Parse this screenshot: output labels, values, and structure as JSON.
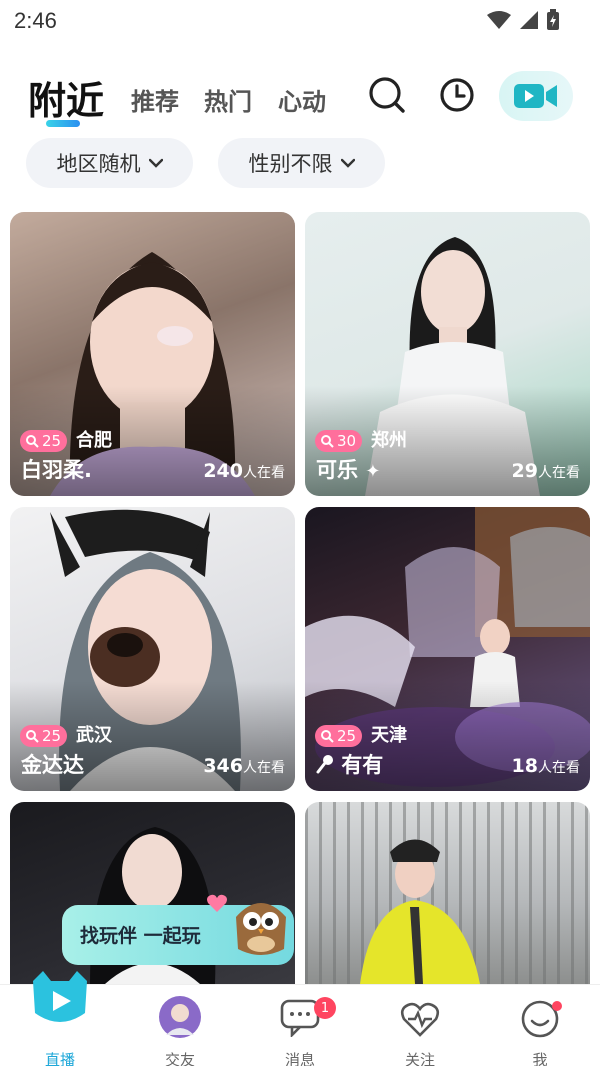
{
  "status_bar": {
    "time": "2:46"
  },
  "header": {
    "tabs": [
      {
        "label": "附近",
        "active": true
      },
      {
        "label": "推荐",
        "active": false
      },
      {
        "label": "热门",
        "active": false
      },
      {
        "label": "心动",
        "active": false
      }
    ],
    "icons": [
      "search-icon",
      "history-clock-icon",
      "video-camera-icon"
    ]
  },
  "filters": {
    "region": "地区随机",
    "gender": "性别不限"
  },
  "cards": [
    {
      "age": "25",
      "city": "合肥",
      "name": "白羽柔.",
      "viewers": "240",
      "viewers_suffix": "人在看"
    },
    {
      "age": "30",
      "city": "郑州",
      "name": "可乐",
      "viewers": "29",
      "viewers_suffix": "人在看"
    },
    {
      "age": "25",
      "city": "武汉",
      "name": "金达达",
      "viewers": "346",
      "viewers_suffix": "人在看"
    },
    {
      "age": "25",
      "city": "天津",
      "name": "有有",
      "viewers": "18",
      "viewers_suffix": "人在看"
    }
  ],
  "popup": {
    "text": "找玩伴 一起玩"
  },
  "bottom_nav": [
    {
      "label": "直播",
      "active": true
    },
    {
      "label": "交友",
      "active": false
    },
    {
      "label": "消息",
      "active": false,
      "badge": "1"
    },
    {
      "label": "关注",
      "active": false
    },
    {
      "label": "我",
      "active": false
    }
  ],
  "colors": {
    "accent": "#1da7d8",
    "badge_pink": "#ff6f9c",
    "notify_red": "#ff4560"
  }
}
